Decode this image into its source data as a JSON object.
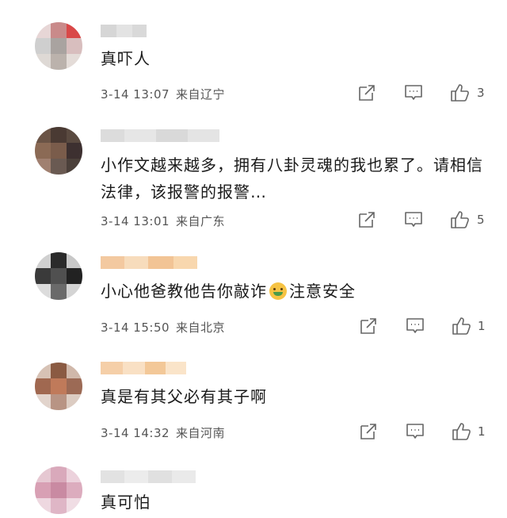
{
  "comments": [
    {
      "text": "真吓人",
      "time": "3-14 13:07",
      "location": "来自辽宁",
      "likes": "3"
    },
    {
      "text": "小作文越来越多，拥有八卦灵魂的我也累了。请相信法律，该报警的报警…",
      "time": "3-14 13:01",
      "location": "来自广东",
      "likes": "5"
    },
    {
      "text_before": "小心他爸教他告你敲诈",
      "text_after": "注意安全",
      "emoji": "sick-face-emoji",
      "time": "3-14 15:50",
      "location": "来自北京",
      "likes": "1"
    },
    {
      "text": "真是有其父必有其子啊",
      "time": "3-14 14:32",
      "location": "来自河南",
      "likes": "1"
    },
    {
      "text": "真可怕"
    }
  ],
  "icons": {
    "share": "share-icon",
    "reply": "comment-icon",
    "like": "thumbs-up-icon"
  },
  "colors": {
    "background": "#ffffff",
    "text": "#1a1a1a",
    "meta": "#555555",
    "icon": "#666666"
  }
}
